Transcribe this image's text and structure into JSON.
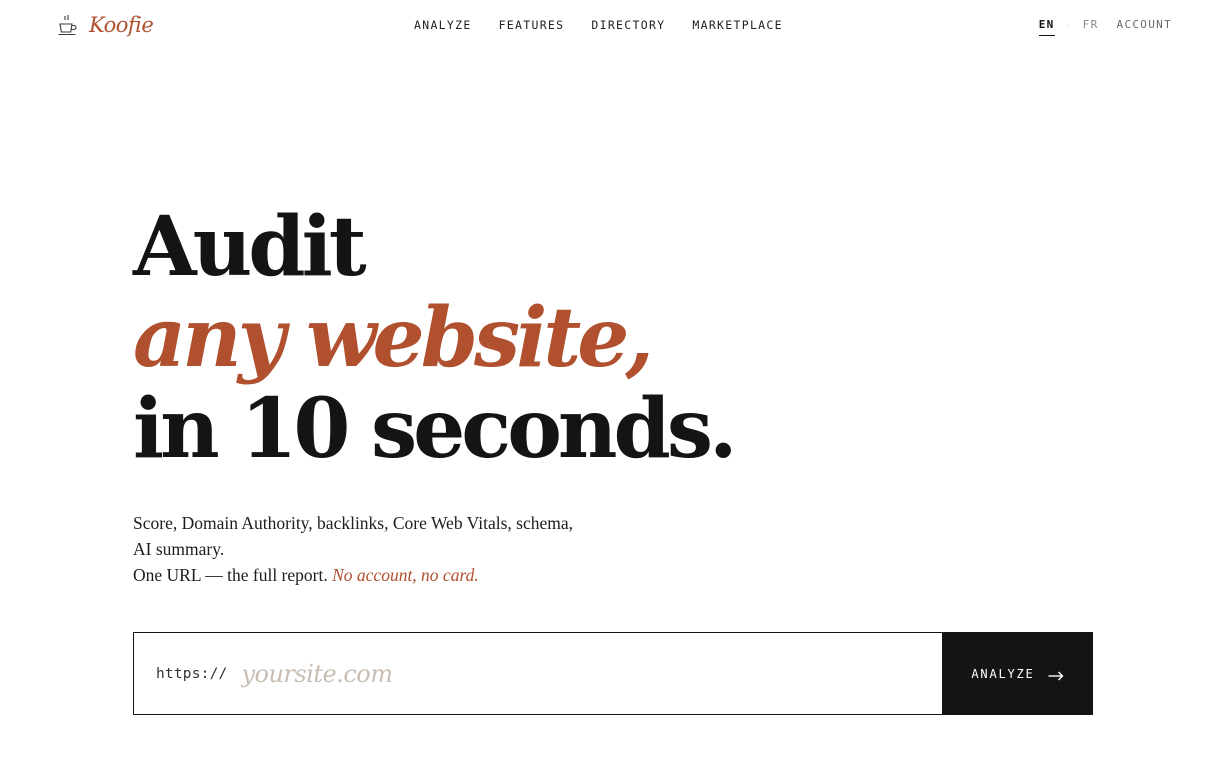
{
  "brand": {
    "name": "Koofie",
    "icon": "coffee-cup-icon",
    "accent_color": "#b0502e"
  },
  "nav": {
    "items": [
      {
        "label": "ANALYZE"
      },
      {
        "label": "FEATURES"
      },
      {
        "label": "DIRECTORY"
      },
      {
        "label": "MARKETPLACE"
      }
    ]
  },
  "lang": {
    "en": "EN",
    "fr": "FR",
    "separator": "·",
    "active": "EN"
  },
  "account_label": "ACCOUNT",
  "hero": {
    "line1": "Audit",
    "line2": "any website,",
    "line3": "in 10 seconds."
  },
  "lead": {
    "line1": "Score, Domain Authority, backlinks, Core Web Vitals, schema, AI summary.",
    "line2": "One URL — the full report.",
    "emphasis": "No account, no card."
  },
  "url_form": {
    "prefix": "https://",
    "placeholder": "yoursite.com",
    "value": "",
    "submit_label": "ANALYZE",
    "submit_icon": "arrow-right-icon"
  }
}
